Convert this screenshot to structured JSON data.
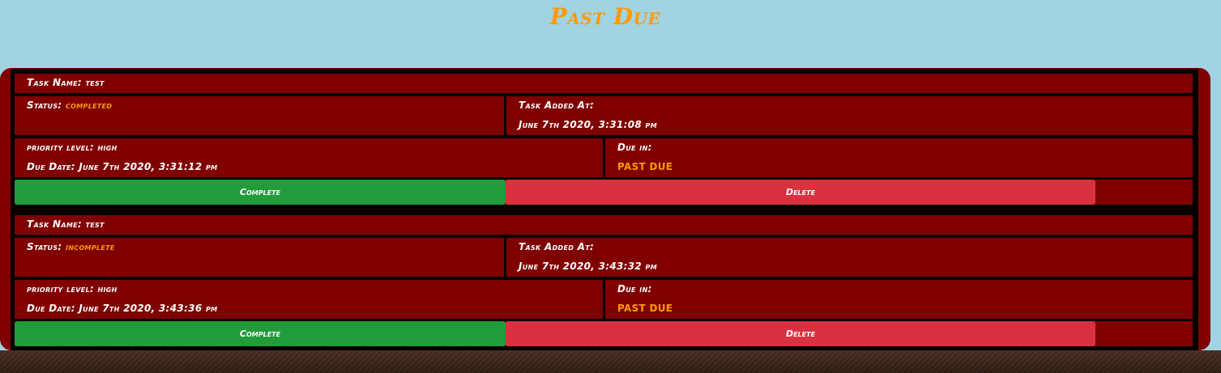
{
  "page": {
    "title": "Past Due"
  },
  "labels": {
    "task_name": "Task Name:",
    "status": "Status:",
    "task_added_at": "Task Added At:",
    "priority_level": "priority level:",
    "due_date": "Due Date:",
    "due_in": "Due in:",
    "complete_button": "Complete",
    "delete_button": "Delete"
  },
  "tasks": [
    {
      "name": "test",
      "status": "completed",
      "added_at": "June 7th 2020, 3:31:08 pm",
      "priority": "high",
      "due_date": "June 7th 2020, 3:31:12 pm",
      "due_in": "PAST DUE"
    },
    {
      "name": "test",
      "status": "incomplete",
      "added_at": "June 7th 2020, 3:43:32 pm",
      "priority": "high",
      "due_date": "June 7th 2020, 3:43:36 pm",
      "due_in": "PAST DUE"
    }
  ],
  "colors": {
    "background": "#a2d3e3",
    "panel": "#800000",
    "accent_orange": "#ff9a00",
    "complete_green": "#229b3b",
    "delete_red": "#d83240"
  }
}
